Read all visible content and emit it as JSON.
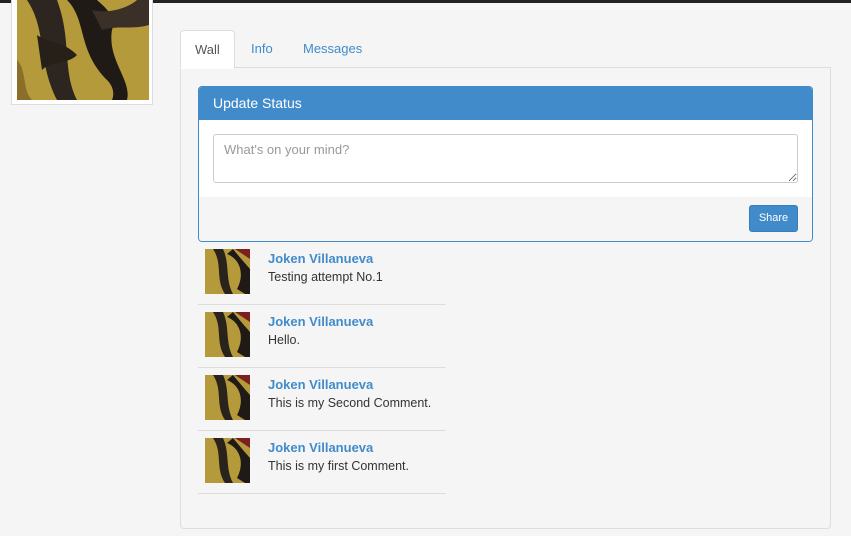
{
  "tabs": [
    {
      "label": "Wall",
      "active": true
    },
    {
      "label": "Info",
      "active": false
    },
    {
      "label": "Messages",
      "active": false
    }
  ],
  "status_panel": {
    "title": "Update Status",
    "placeholder": "What's on your mind?",
    "value": "",
    "share_label": "Share"
  },
  "comments": [
    {
      "author": "Joken Villanueva",
      "text": "Testing attempt No.1"
    },
    {
      "author": "Joken Villanueva",
      "text": "Hello."
    },
    {
      "author": "Joken Villanueva",
      "text": "This is my Second Comment."
    },
    {
      "author": "Joken Villanueva",
      "text": "This is my first Comment."
    }
  ],
  "colors": {
    "accent": "#428bca",
    "background": "#f5f5f5",
    "border": "#dddddd"
  }
}
